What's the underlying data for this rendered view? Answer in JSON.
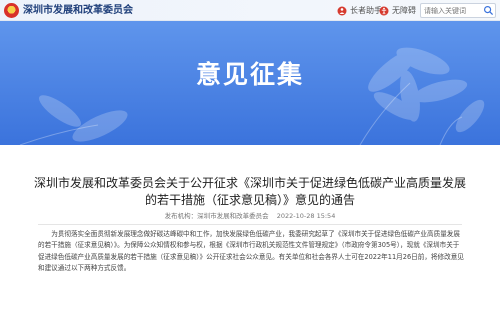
{
  "header": {
    "org_name": "深圳市发展和改革委员会",
    "elder_mode": "长者助手",
    "accessibility": "无障碍",
    "search_placeholder": "请输入关键词"
  },
  "banner": {
    "title": "意见征集"
  },
  "article": {
    "title": "深圳市发展和改革委员会关于公开征求《深圳市关于促进绿色低碳产业高质量发展的若干措施（征求意见稿）》意见的通告",
    "source": "发布机构：深圳市发展和改革委员会",
    "date": "2022-10-28 15:54",
    "body": "为贯彻落实全面贯彻新发展理念做好碳达峰碳中和工作，加快发展绿色低碳产业，我委研究起草了《深圳市关于促进绿色低碳产业高质量发展的若干措施（征求意见稿）》。为保障公众知情权和参与权，根据《深圳市行政机关规范性文件管理规定》（市政府令第305号），现就《深圳市关于促进绿色低碳产业高质量发展的若干措施（征求意见稿）》公开征求社会公众意见。有关单位和社会各界人士可在2022年11月26日前，将修改意见和建议通过以下两种方式反馈。"
  },
  "colors": {
    "banner_top": "#5f95ec",
    "banner_bottom": "#3b73dc",
    "org_name": "#1f3f7a"
  }
}
